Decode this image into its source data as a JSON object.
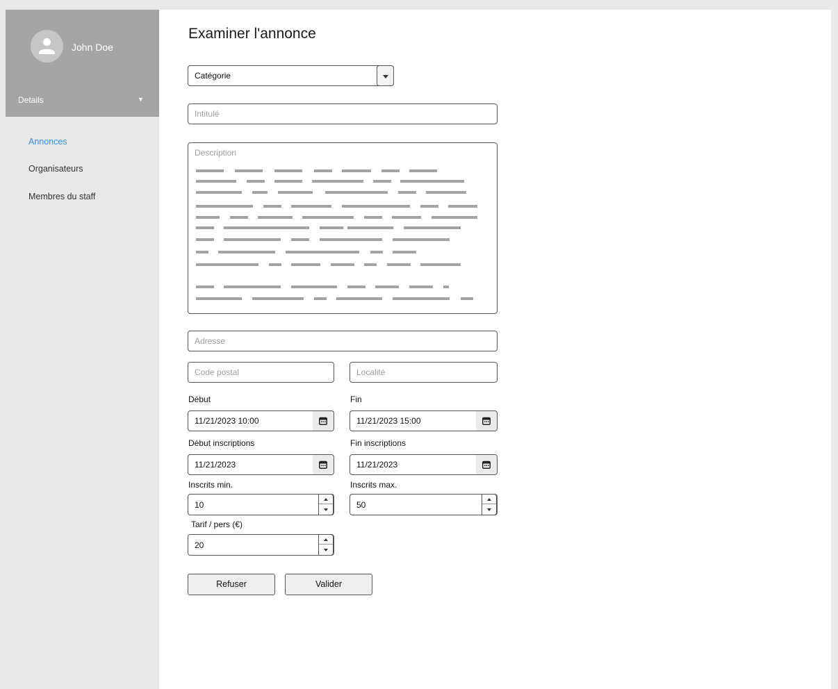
{
  "user": {
    "name": "John Doe"
  },
  "sidebar": {
    "details_label": "Details",
    "items": [
      {
        "label": "Annonces",
        "active": true
      },
      {
        "label": "Organisateurs",
        "active": false
      },
      {
        "label": "Membres du staff",
        "active": false
      }
    ]
  },
  "page": {
    "title": "Examiner l'annonce"
  },
  "form": {
    "category": {
      "value": "Catégorie"
    },
    "title": {
      "placeholder": "Intitulé"
    },
    "description": {
      "placeholder": "Description"
    },
    "address": {
      "placeholder": "Adresse"
    },
    "postal_code": {
      "placeholder": "Code postal"
    },
    "city": {
      "placeholder": "Localité"
    },
    "start": {
      "label": "Début",
      "value": "11/21/2023 10:00"
    },
    "end": {
      "label": "Fin",
      "value": "11/21/2023 15:00"
    },
    "registration_start": {
      "label": "Début inscriptions",
      "value": "11/21/2023"
    },
    "registration_end": {
      "label": "Fin inscriptions",
      "value": "11/21/2023"
    },
    "min_participants": {
      "label": "Inscrits min.",
      "value": "10"
    },
    "max_participants": {
      "label": "Inscrits max.",
      "value": "50"
    },
    "price": {
      "label": "Tarif / pers (€)",
      "value": "20"
    }
  },
  "actions": {
    "refuse_label": "Refuser",
    "validate_label": "Valider"
  },
  "colors": {
    "sidebar_header": "#a5a5a5",
    "sidebar_bg": "#e8e8e8",
    "active_link": "#3a8fe0"
  },
  "icons": [
    "user-icon",
    "caret-down-icon",
    "calendar-icon",
    "spinner-up-icon",
    "spinner-down-icon"
  ]
}
